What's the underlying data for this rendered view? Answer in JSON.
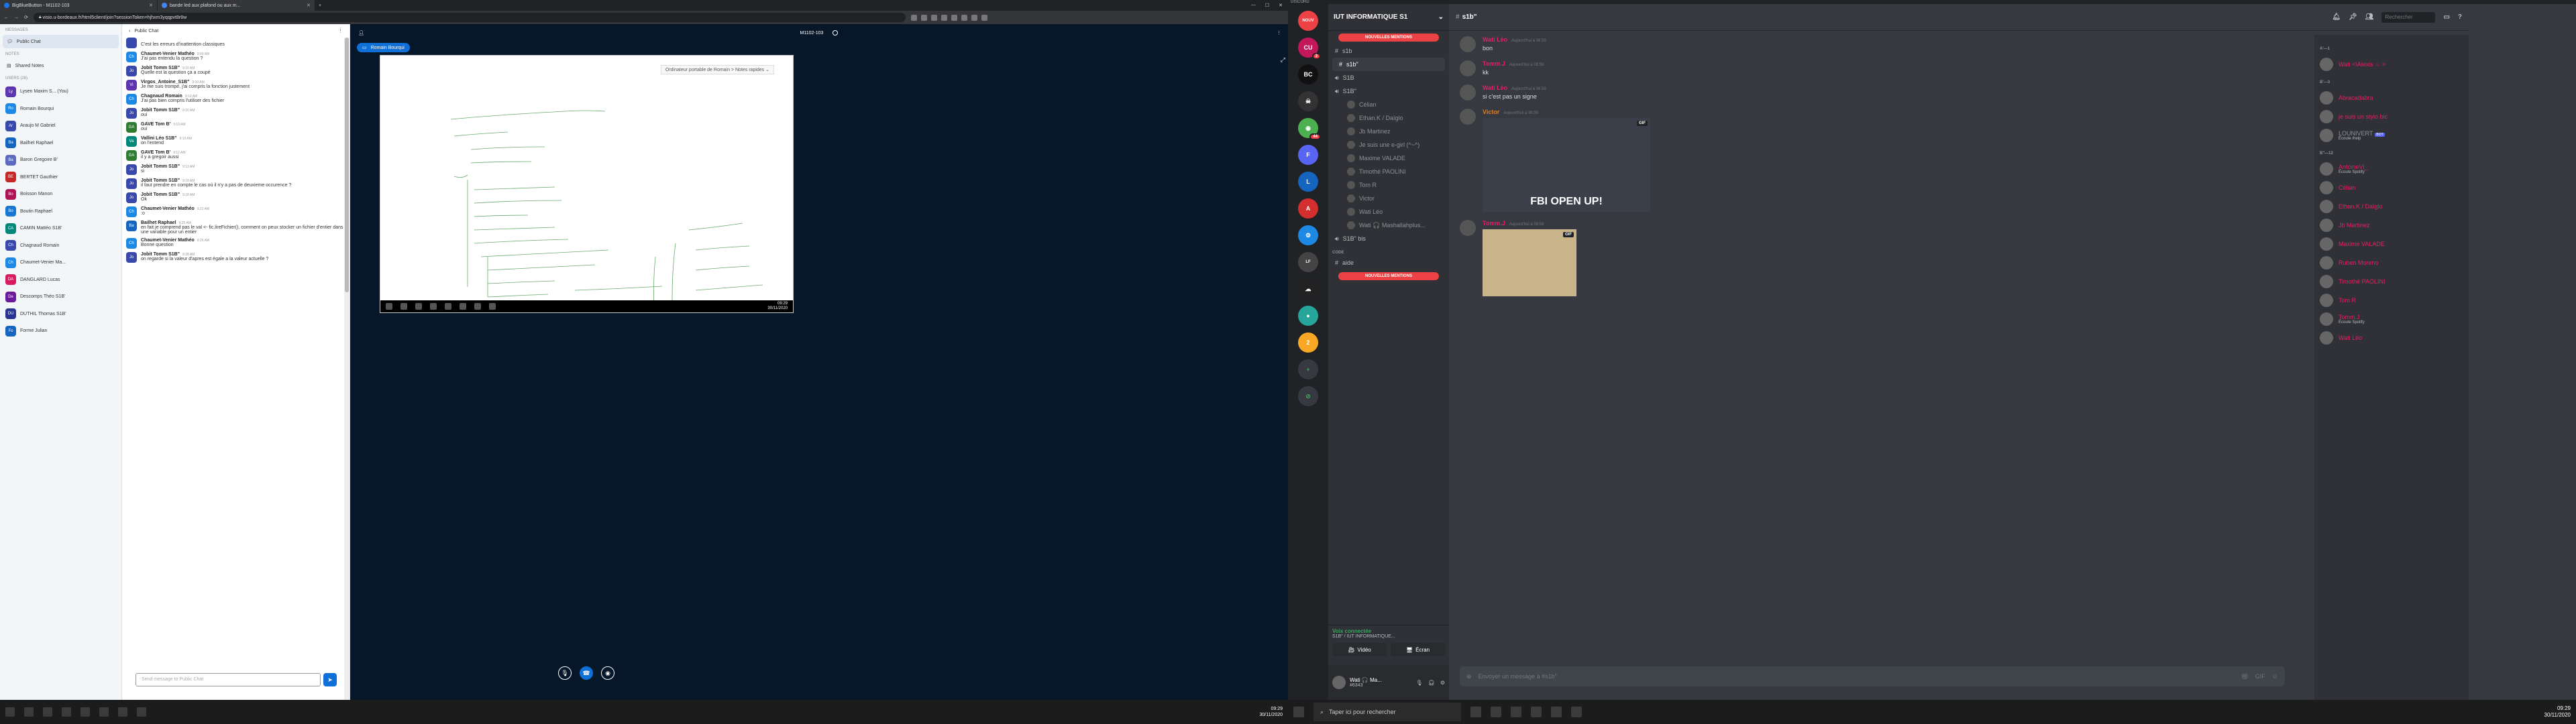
{
  "browser": {
    "tabs": [
      {
        "label": "BigBlueButton - M1102-103"
      },
      {
        "label": "bande led aux plafond ou aux m..."
      }
    ],
    "url": "visio.u-bordeaux.fr/html5client/join?sessionToken=hjhxm3yqqpvt8r8w"
  },
  "bbb": {
    "sidebar": {
      "messages_heading": "MESSAGES",
      "public_chat": "Public Chat",
      "notes_heading": "NOTES",
      "shared_notes": "Shared Notes",
      "users_heading": "USERS (28)",
      "users": [
        {
          "initials": "Ly",
          "name": "Lysen Maxim S... (You)",
          "color": "#5e35b1"
        },
        {
          "initials": "Ro",
          "name": "Romain Bourqui",
          "color": "#1e88e5"
        },
        {
          "initials": "Ar",
          "name": "Araujo M Gabriel",
          "color": "#3949ab"
        },
        {
          "initials": "Ba",
          "name": "Bailhet Raphael",
          "color": "#1565c0"
        },
        {
          "initials": "Ba",
          "name": "Baron Gregoire B'",
          "color": "#5c6bc0"
        },
        {
          "initials": "BE",
          "name": "BERTET Gauthier",
          "color": "#c62828"
        },
        {
          "initials": "Bo",
          "name": "Boisson Manon",
          "color": "#ad1457"
        },
        {
          "initials": "Bo",
          "name": "Boutin Raphael",
          "color": "#1976d2"
        },
        {
          "initials": "CA",
          "name": "CAMIN Mattéo S1B'",
          "color": "#00897b"
        },
        {
          "initials": "Ch",
          "name": "Chagnaud Romain",
          "color": "#3949ab"
        },
        {
          "initials": "Ch",
          "name": "Chaumet-Venier Ma...",
          "color": "#1e88e5"
        },
        {
          "initials": "DA",
          "name": "DANGLARD Lucas",
          "color": "#d81b60"
        },
        {
          "initials": "De",
          "name": "Descomps Théo S1B'",
          "color": "#6a1b9a"
        },
        {
          "initials": "DU",
          "name": "DUTHIL Thomas S1B'",
          "color": "#283593"
        },
        {
          "initials": "Fo",
          "name": "Forme Julian",
          "color": "#1565c0"
        }
      ]
    },
    "chat": {
      "title": "Public Chat",
      "messages": [
        {
          "initials": "",
          "color": "#3949ab",
          "name": "",
          "time": "",
          "text": "C'est les erreurs d'inattention classiques"
        },
        {
          "initials": "Ch",
          "color": "#1e88e5",
          "name": "Chaumet-Venier Mathéo",
          "time": "9:09 AM",
          "text": "J'ai pas entendu la question ?"
        },
        {
          "initials": "Jo",
          "color": "#3949ab",
          "name": "Jobit Tomm S1B\"",
          "time": "9:10 AM",
          "text": "Quelle est la question ça a coupé"
        },
        {
          "initials": "Vi",
          "color": "#5e35b1",
          "name": "Virgos_Antoine_S1B\"",
          "time": "9:10 AM",
          "text": "Je me suis trompé, j'ai compris la fonction justement"
        },
        {
          "initials": "Ch",
          "color": "#1e88e5",
          "name": "Chagnaud Romain",
          "time": "9:10 AM",
          "text": "J'ai pas bien compris l'utiliser des fichier"
        },
        {
          "initials": "Jo",
          "color": "#3949ab",
          "name": "Jobit Tomm S1B\"",
          "time": "9:10 AM",
          "text": "oui"
        },
        {
          "initials": "GA",
          "color": "#2e7d32",
          "name": "GAVE Tom B'",
          "time": "9:10 AM",
          "text": "oui"
        },
        {
          "initials": "Va",
          "color": "#00897b",
          "name": "Vallini Léo S1B\"",
          "time": "9:10 AM",
          "text": "on l'entend"
        },
        {
          "initials": "GA",
          "color": "#2e7d32",
          "name": "GAVE Tom B'",
          "time": "9:12 AM",
          "text": "il y a gregoir aussi"
        },
        {
          "initials": "Jo",
          "color": "#3949ab",
          "name": "Jobit Tomm S1B\"",
          "time": "9:13 AM",
          "text": "si"
        },
        {
          "initials": "Jo",
          "color": "#3949ab",
          "name": "Jobit Tomm S1B\"",
          "time": "9:18 AM",
          "text": "il faut prendre en compte le cas où il n'y a pas de deuxieme occurence ?"
        },
        {
          "initials": "Jo",
          "color": "#3949ab",
          "name": "Jobit Tomm S1B\"",
          "time": "9:18 AM",
          "text": "Ok"
        },
        {
          "initials": "Ch",
          "color": "#1e88e5",
          "name": "Chaumet-Venier Mathéo",
          "time": "9:22 AM",
          "text": ":o"
        },
        {
          "initials": "Ba",
          "color": "#1565c0",
          "name": "Bailhet Raphael",
          "time": "9:25 AM",
          "text": "en fait je comprend pas le val <- fic.lireFichier(), comment on peux stocker un fichier d'entier dans une variable pour un entier"
        },
        {
          "initials": "Ch",
          "color": "#1e88e5",
          "name": "Chaumet-Venier Mathéo",
          "time": "9:26 AM",
          "text": "Bonne question"
        },
        {
          "initials": "Jo",
          "color": "#3949ab",
          "name": "Jobit Tomm S1B\"",
          "time": "9:28 AM",
          "text": "on regarde si la valeur d'apres est égale a la valeur actuelle ?"
        }
      ],
      "input_placeholder": "Send message to Public Chat"
    },
    "main": {
      "room": "M1102-103",
      "presenter": "Romain Bourqui",
      "notes_dropdown": "Ordinateur portable de Romain > Notes rapides",
      "slide_clock_time": "09:29",
      "slide_clock_date": "30/11/2020"
    },
    "taskbar": {
      "time": "09:29",
      "date": "30/11/2020"
    }
  },
  "discord": {
    "topbar": "DISCORD",
    "server_name": "IUT INFORMATIQUE S1",
    "new_mentions": "NOUVELLES MENTIONS",
    "channels": [
      "s1b",
      "s1b\"",
      "S1B",
      "S1B\""
    ],
    "voice_users": [
      "Célian",
      "Ethan.K / Daïglo",
      "Jb Martinez",
      "Je suis une e-girl (^~^)",
      "Maxime VALADE",
      "Timothé PAOLINI",
      "Tom R",
      "Victor",
      "Wati Léo",
      "Wati 🎧 Mashallahplus..."
    ],
    "channel_after": "S1B\" bis",
    "category": "CODE",
    "channel_cut": "aide",
    "voice_connected": "Voix connectée",
    "voice_server": "S1B\" / IUT INFORMATIQUE...",
    "video_btn": "Vidéo",
    "screen_btn": "Écran",
    "me_name": "Wati 🎧 Ma...",
    "me_tag": "#6343",
    "channel_title": "s1b\"",
    "search_placeholder": "Rechercher",
    "messages": [
      {
        "name": "Wati Léo",
        "color": "#e91e63",
        "time": "Aujourd'hui à 08:59",
        "text": "bon",
        "gif": ""
      },
      {
        "name": "Tomm.J",
        "color": "#e91e63",
        "time": "Aujourd'hui à 08:59",
        "text": "kk",
        "gif": ""
      },
      {
        "name": "Wati Léo",
        "color": "#e91e63",
        "time": "Aujourd'hui à 08:59",
        "text": "si c'est pas un signe",
        "gif": ""
      },
      {
        "name": "Victor",
        "color": "#e67e22",
        "time": "Aujourd'hui à 08:59",
        "text": "",
        "gif": "FBI OPEN UP!"
      },
      {
        "name": "Tomm.J",
        "color": "#e91e63",
        "time": "Aujourd'hui à 08:59",
        "text": "",
        "gif": "anime"
      }
    ],
    "composer_placeholder": "Envoyer un message à #s1b\"",
    "member_groups": [
      {
        "label": "A'—1",
        "members": [
          {
            "name": "Wati <\\Alexis ♤ >",
            "color": "#e91e63",
            "status": ""
          }
        ]
      },
      {
        "label": "B'—3",
        "members": [
          {
            "name": "Abracadabra",
            "color": "#e91e63",
            "status": ""
          },
          {
            "name": "je suis un stylo bic",
            "color": "#e91e63",
            "status": ""
          },
          {
            "name": "LOUNIVERT",
            "color": "#8e9297",
            "status": "Écoute /help",
            "bot": "BOT"
          }
        ]
      },
      {
        "label": "B\"—12",
        "members": [
          {
            "name": "AntoineVi_",
            "color": "#e91e63",
            "status": "Écoute Spotify"
          },
          {
            "name": "Célian",
            "color": "#e91e63",
            "status": ""
          },
          {
            "name": "Ethan.K / Daïglo",
            "color": "#e91e63",
            "status": ""
          },
          {
            "name": "Jb Martinez",
            "color": "#e91e63",
            "status": ""
          },
          {
            "name": "Maxime VALADE",
            "color": "#e91e63",
            "status": ""
          },
          {
            "name": "Ruben Moreno",
            "color": "#e91e63",
            "status": ""
          },
          {
            "name": "Timothé PAOLINI",
            "color": "#e91e63",
            "status": ""
          },
          {
            "name": "Tom R",
            "color": "#e91e63",
            "status": ""
          },
          {
            "name": "Tomm.J",
            "color": "#e91e63",
            "status": "Écoute Spotify"
          },
          {
            "name": "Wati Léo",
            "color": "#e91e63",
            "status": ""
          }
        ]
      }
    ],
    "taskbar": {
      "search": "Taper ici pour rechercher",
      "time": "09:29",
      "date": "30/11/2020"
    }
  }
}
